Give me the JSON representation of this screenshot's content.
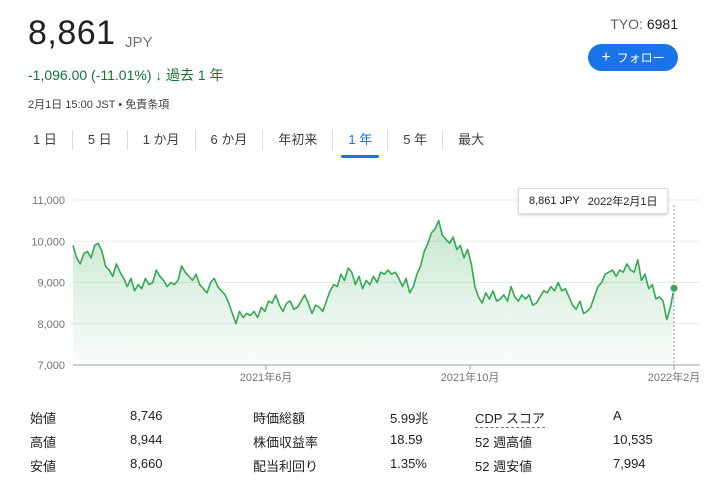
{
  "quote": {
    "price": "8,861",
    "currency": "JPY",
    "change": "-1,096.00 (-11.01%)",
    "change_arrow": "↓",
    "period": "過去 1 年",
    "timestamp": "2月1日 15:00 JST • 免責条項",
    "ticker_exchange": "TYO:",
    "ticker_code": "6981",
    "follow_label": "フォロー"
  },
  "ranges": [
    "1 日",
    "5 日",
    "1 か月",
    "6 か月",
    "年初来",
    "1 年",
    "5 年",
    "最大"
  ],
  "active_range": "1 年",
  "tooltip": {
    "value": "8,861 JPY",
    "date": "2022年2月1日"
  },
  "chart_data": {
    "type": "area",
    "color": "#34a853",
    "ylim": [
      7000,
      11000
    ],
    "y_ticks": [
      "11,000",
      "10,000",
      "9,000",
      "8,000",
      "7,000"
    ],
    "x_ticks": [
      "2021年6月",
      "2021年10月",
      "2022年2月"
    ],
    "grid": true,
    "values": [
      9900,
      9600,
      9450,
      9700,
      9750,
      9600,
      9900,
      9950,
      9750,
      9400,
      9300,
      9150,
      9450,
      9250,
      9100,
      8900,
      9100,
      8800,
      8950,
      8850,
      9100,
      8950,
      9000,
      9300,
      9150,
      9050,
      8900,
      9000,
      8950,
      9050,
      9400,
      9250,
      9150,
      9050,
      9200,
      8950,
      8850,
      8750,
      9000,
      9100,
      8900,
      8800,
      8700,
      8500,
      8250,
      8000,
      8300,
      8150,
      8250,
      8200,
      8300,
      8150,
      8400,
      8300,
      8550,
      8500,
      8700,
      8450,
      8300,
      8500,
      8550,
      8350,
      8400,
      8550,
      8700,
      8500,
      8250,
      8450,
      8400,
      8300,
      8550,
      8800,
      8950,
      8900,
      9200,
      9050,
      9350,
      9250,
      8950,
      9150,
      8850,
      9050,
      8950,
      9150,
      9000,
      9250,
      9200,
      9300,
      9200,
      9250,
      9100,
      8900,
      9100,
      8750,
      8900,
      9200,
      9400,
      9750,
      9950,
      10200,
      10300,
      10500,
      10150,
      10050,
      9950,
      10100,
      9800,
      9900,
      9600,
      9800,
      9450,
      8900,
      8650,
      8500,
      8750,
      8600,
      8800,
      8550,
      8600,
      8700,
      8550,
      8900,
      8650,
      8550,
      8700,
      8600,
      8700,
      8450,
      8500,
      8650,
      8800,
      8750,
      8900,
      8800,
      9000,
      8800,
      8850,
      8650,
      8450,
      8350,
      8550,
      8250,
      8300,
      8400,
      8650,
      8900,
      9000,
      9200,
      9250,
      9300,
      9150,
      9300,
      9250,
      9450,
      9300,
      9250,
      9550,
      9050,
      9200,
      8850,
      8950,
      8600,
      8650,
      8550,
      8100,
      8400,
      8861
    ],
    "last_value": 8861
  },
  "stats": [
    {
      "label": "始値",
      "value": "8,746"
    },
    {
      "label": "高値",
      "value": "8,944"
    },
    {
      "label": "安値",
      "value": "8,660"
    },
    {
      "label": "時価総額",
      "value": "5.99兆"
    },
    {
      "label": "株価収益率",
      "value": "18.59"
    },
    {
      "label": "配当利回り",
      "value": "1.35%"
    },
    {
      "label": "CDP スコア",
      "value": "A"
    },
    {
      "label": "52 週高値",
      "value": "10,535"
    },
    {
      "label": "52 週安値",
      "value": "7,994"
    }
  ]
}
